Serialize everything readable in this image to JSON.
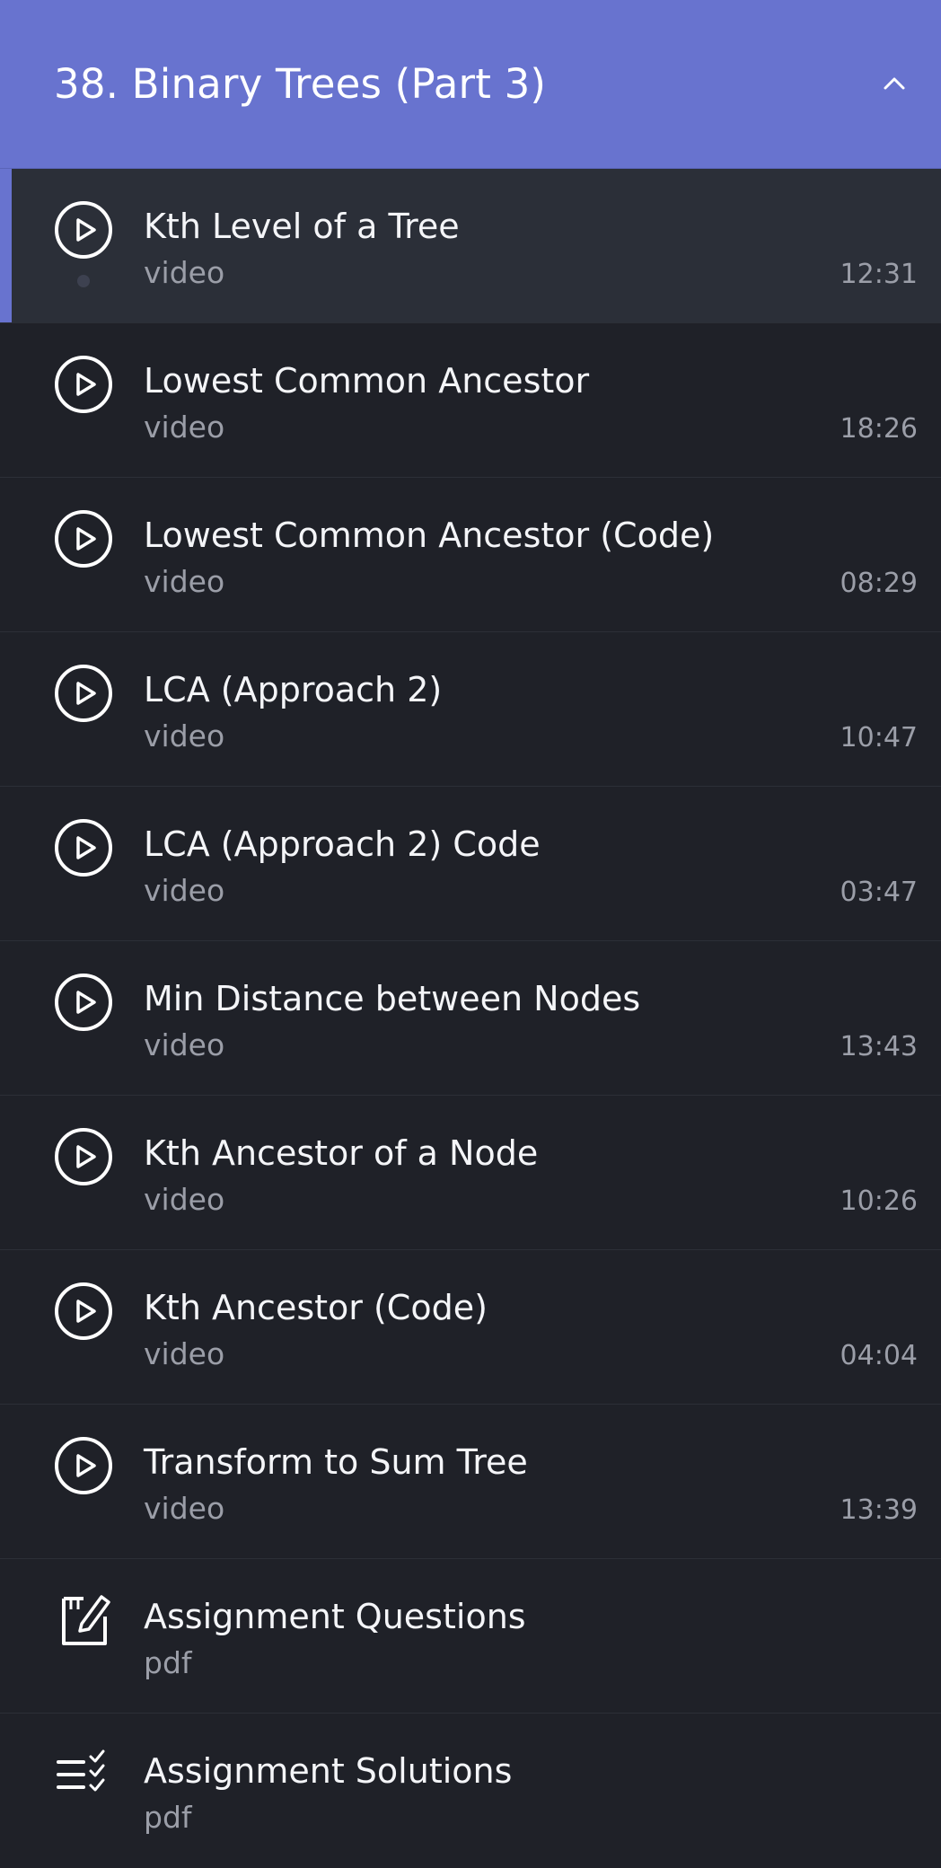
{
  "section": {
    "title": "38. Binary Trees (Part 3)",
    "collapse_icon": "chevron-up-icon"
  },
  "items": [
    {
      "title": "Kth Level of a Tree",
      "type": "video",
      "duration": "12:31",
      "icon": "play-circle-icon",
      "active": true
    },
    {
      "title": "Lowest Common Ancestor",
      "type": "video",
      "duration": "18:26",
      "icon": "play-circle-icon"
    },
    {
      "title": "Lowest Common Ancestor (Code)",
      "type": "video",
      "duration": "08:29",
      "icon": "play-circle-icon"
    },
    {
      "title": "LCA (Approach 2)",
      "type": "video",
      "duration": "10:47",
      "icon": "play-circle-icon"
    },
    {
      "title": "LCA (Approach 2) Code",
      "type": "video",
      "duration": "03:47",
      "icon": "play-circle-icon"
    },
    {
      "title": "Min Distance between Nodes",
      "type": "video",
      "duration": "13:43",
      "icon": "play-circle-icon"
    },
    {
      "title": "Kth Ancestor of a Node",
      "type": "video",
      "duration": "10:26",
      "icon": "play-circle-icon"
    },
    {
      "title": "Kth Ancestor (Code)",
      "type": "video",
      "duration": "04:04",
      "icon": "play-circle-icon"
    },
    {
      "title": "Transform to Sum Tree",
      "type": "video",
      "duration": "13:39",
      "icon": "play-circle-icon"
    },
    {
      "title": "Assignment Questions",
      "type": "pdf",
      "icon": "edit-document-icon"
    },
    {
      "title": "Assignment Solutions",
      "type": "pdf",
      "icon": "checklist-icon"
    }
  ],
  "colors": {
    "accent": "#6873cf",
    "background": "#1f2128",
    "active_row": "#2b2f38"
  }
}
